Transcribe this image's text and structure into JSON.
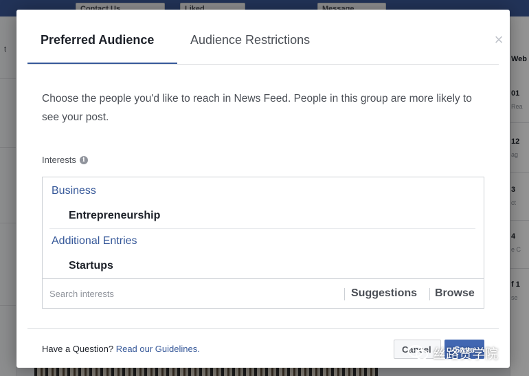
{
  "background": {
    "topbar_buttons": [
      "Contact Us",
      "Liked",
      "Message"
    ],
    "right_column": [
      {
        "title": "Web",
        "sub": ""
      },
      {
        "title": "01",
        "sub": "Rea"
      },
      {
        "title": "12",
        "sub": "ag"
      },
      {
        "title": "3",
        "sub": "ct"
      },
      {
        "title": "4",
        "sub": "e C"
      },
      {
        "title": "f 1",
        "sub": "se"
      }
    ],
    "left_column_text": "t"
  },
  "dialog": {
    "tabs": [
      {
        "label": "Preferred Audience",
        "active": true
      },
      {
        "label": "Audience Restrictions",
        "active": false
      }
    ],
    "close_glyph": "×",
    "description": "Choose the people you'd like to reach in News Feed. People in this group are more likely to see your post.",
    "interests": {
      "label": "Interests",
      "info_glyph": "i",
      "groups": [
        {
          "category": "Business",
          "item": "Entrepreneurship"
        },
        {
          "category": "Additional Entries",
          "item": "Startups"
        }
      ],
      "search_placeholder": "Search interests",
      "suggestions_label": "Suggestions",
      "browse_label": "Browse"
    },
    "footer": {
      "question": "Have a Question?",
      "link": "Read our Guidelines."
    },
    "buttons": {
      "cancel": "Cancel",
      "save": "Save"
    }
  },
  "watermark": {
    "text": "丝路赞学院"
  },
  "colors": {
    "accent": "#365899",
    "primary_button": "#4267b2",
    "topbar": "#3b5998"
  }
}
